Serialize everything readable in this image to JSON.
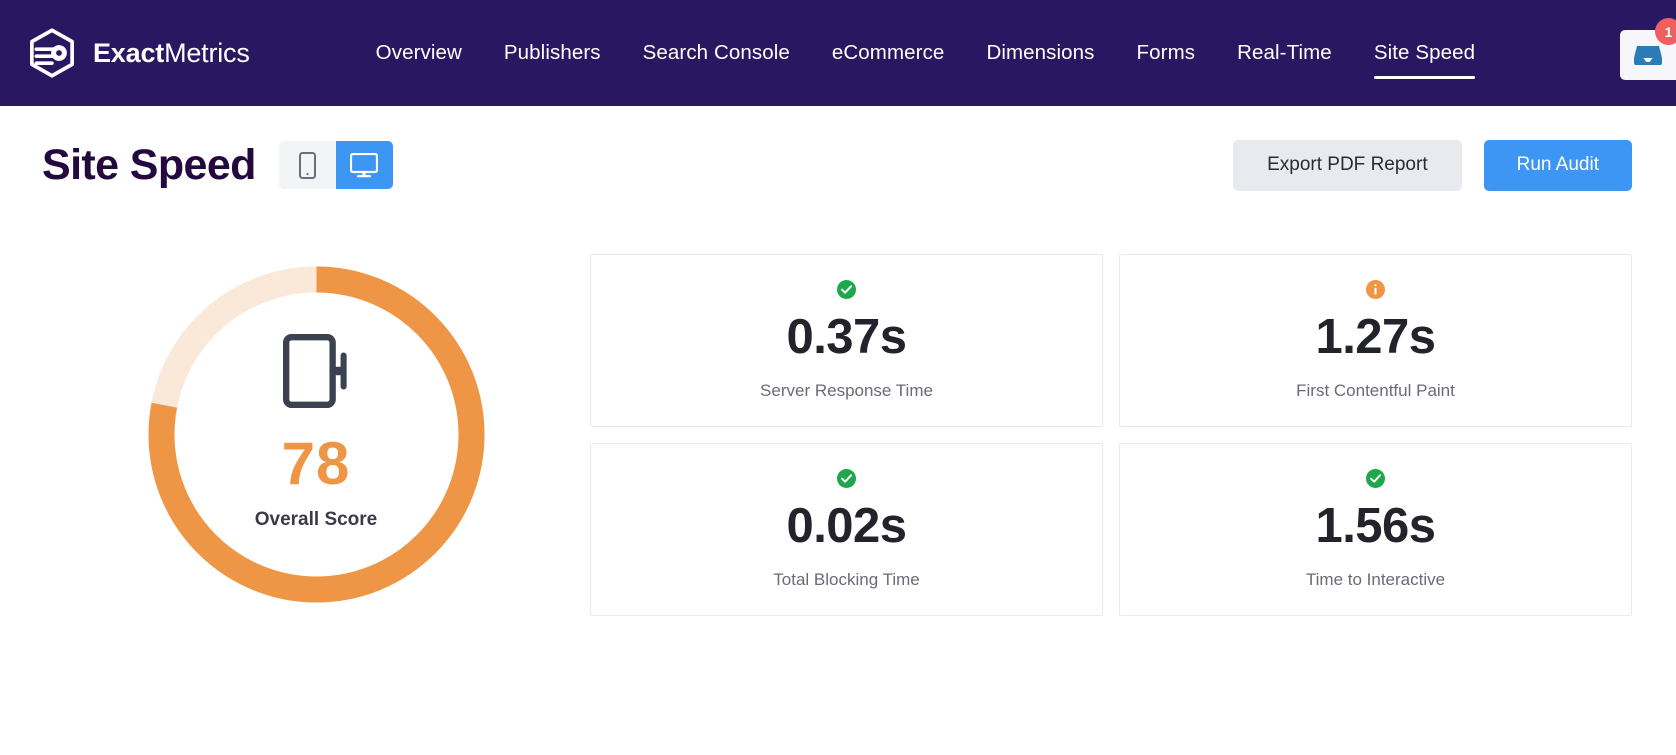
{
  "topbar": {
    "brand": {
      "bold": "Exact",
      "regular": "Metrics",
      "logo_icon": "exactmetrics-hexagon-logo"
    },
    "nav": [
      {
        "label": "Overview",
        "active": false
      },
      {
        "label": "Publishers",
        "active": false
      },
      {
        "label": "Search Console",
        "active": false
      },
      {
        "label": "eCommerce",
        "active": false
      },
      {
        "label": "Dimensions",
        "active": false
      },
      {
        "label": "Forms",
        "active": false
      },
      {
        "label": "Real-Time",
        "active": false
      },
      {
        "label": "Site Speed",
        "active": true
      }
    ],
    "inbox": {
      "icon": "inbox-tray-icon",
      "badge_count": "1",
      "badge_color": "#f05f5f"
    }
  },
  "page_header": {
    "title": "Site Speed",
    "device_toggle": [
      {
        "name": "mobile",
        "icon": "mobile-phone-icon",
        "active": false
      },
      {
        "name": "desktop",
        "icon": "desktop-monitor-icon",
        "active": true
      }
    ],
    "export_button": "Export PDF Report",
    "run_audit_button": "Run Audit"
  },
  "score": {
    "value": "78",
    "percent": 78,
    "label": "Overall Score",
    "device_icon": "desktop-monitor-icon",
    "arc_color": "#EE9645",
    "track_color": "#FAE8D8"
  },
  "metrics": [
    {
      "status": "good",
      "status_icon": "check-circle-icon",
      "value": "0.37s",
      "label": "Server Response Time"
    },
    {
      "status": "warning",
      "status_icon": "info-circle-icon",
      "value": "1.27s",
      "label": "First Contentful Paint"
    },
    {
      "status": "good",
      "status_icon": "check-circle-icon",
      "value": "0.02s",
      "label": "Total Blocking Time"
    },
    {
      "status": "good",
      "status_icon": "check-circle-icon",
      "value": "1.56s",
      "label": "Time to Interactive"
    }
  ],
  "colors": {
    "header_bg": "#2A1761",
    "accent_blue": "#3E96F4",
    "orange": "#EE9645",
    "green": "#1FA84B",
    "title_purple": "#23093D"
  }
}
